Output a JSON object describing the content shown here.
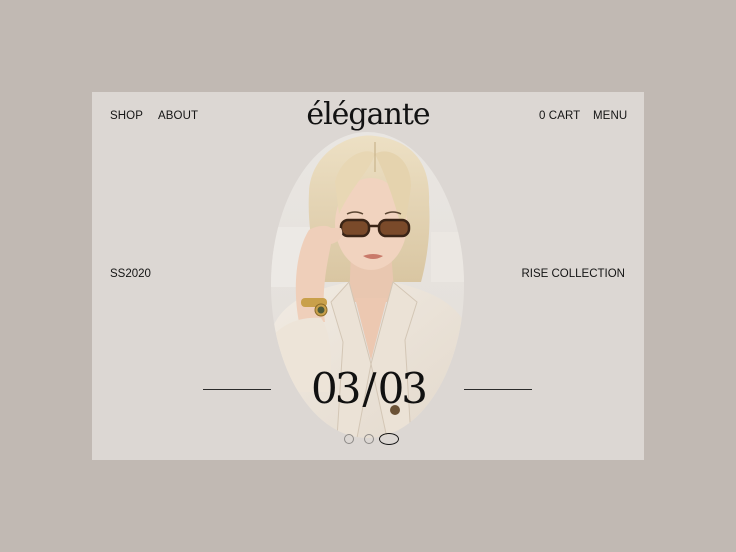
{
  "nav": {
    "left": [
      {
        "label": "SHOP"
      },
      {
        "label": "ABOUT"
      }
    ],
    "right": [
      {
        "label": "0 CART"
      },
      {
        "label": "MENU"
      }
    ]
  },
  "brand": {
    "logo": "élégante"
  },
  "hero": {
    "season": "SS2020",
    "collection": "RISE COLLECTION",
    "image": "model-in-sunglasses-photo"
  },
  "slider": {
    "current": "03",
    "separator": "/",
    "total": "03",
    "dots": [
      {
        "active": false
      },
      {
        "active": false
      },
      {
        "active": true
      }
    ]
  },
  "colors": {
    "page_bg": "#c1b9b3",
    "frame_bg": "#dcd7d3",
    "text": "#141414"
  }
}
